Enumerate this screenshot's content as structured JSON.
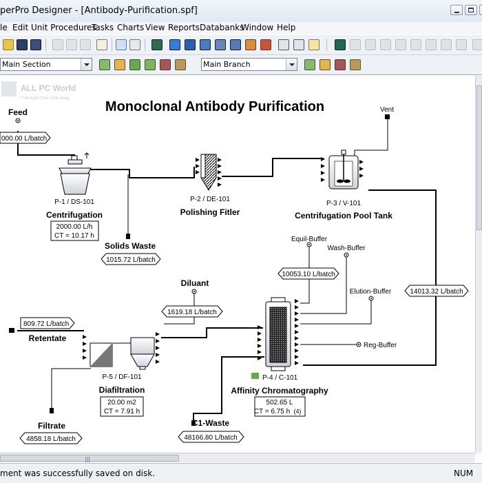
{
  "window": {
    "title": "perPro Designer - [Antibody-Purification.spf]"
  },
  "menu": [
    "le",
    "Edit",
    "Unit Procedures",
    "Tasks",
    "Charts",
    "View",
    "Reports",
    "Databanks",
    "Window",
    "Help"
  ],
  "toolbar": {
    "section_combo": "Main Section",
    "branch_combo": "Main Branch"
  },
  "diagram": {
    "title": "Monoclonal Antibody Purification",
    "watermark": {
      "line1": "ALL PC World",
      "line2": "Free Apps One Click Away"
    },
    "streams": {
      "feed": {
        "label": "Feed",
        "value": "000.00 L/batch"
      },
      "vent": {
        "label": "Vent"
      },
      "solids_waste": {
        "label": "Solids Waste",
        "value": "1015.72 L/batch"
      },
      "equil_buffer": {
        "label": "Equil-Buffer",
        "value": "10053.10 L/batch"
      },
      "wash_buffer": {
        "label": "Wash-Buffer"
      },
      "elution_buffer": {
        "label": "Elution-Buffer"
      },
      "reg_buffer": {
        "label": "Reg-Buffer"
      },
      "recycle": {
        "value": "14013.32 L/batch"
      },
      "diluant": {
        "label": "Diluant",
        "value": "1619.18 L/batch"
      },
      "retentate": {
        "label": "Retentate",
        "value": "809.72 L/batch"
      },
      "filtrate": {
        "label": "Filtrate",
        "value": "4858.18 L/batch"
      },
      "c1_waste": {
        "label": "C1-Waste",
        "value": "48166.80 L/batch"
      }
    },
    "units": {
      "p1": {
        "tag": "P-1 / DS-101",
        "name": "Centrifugation",
        "line1": "2000.00 L/h",
        "line2": "CT = 10.17 h"
      },
      "p2": {
        "tag": "P-2 / DE-101",
        "name": "Polishing Fitler"
      },
      "p3": {
        "tag": "P-3 / V-101",
        "name": "Centrifugation Pool Tank"
      },
      "p4": {
        "tag": "P-4 / C-101",
        "name": "Affinity Chromatography",
        "line1": "502.65 L",
        "line2": "CT = 6.75 h",
        "badge": "(4)"
      },
      "p5": {
        "tag": "P-5 / DF-101",
        "name": "Diafiltration",
        "line1": "20.00 m2",
        "line2": "CT = 7.91 h"
      }
    }
  },
  "status": {
    "message": "ment was successfully saved on disk.",
    "num": "NUM"
  }
}
